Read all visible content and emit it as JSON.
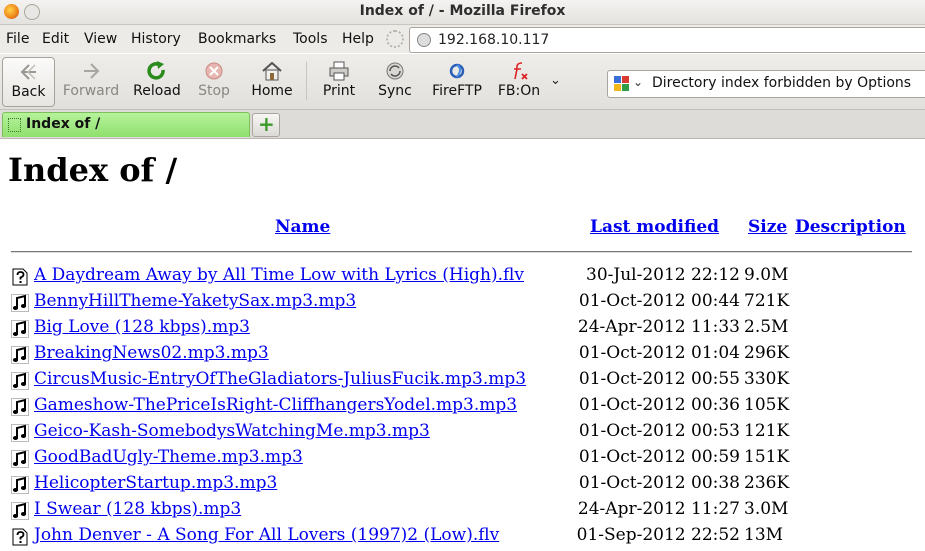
{
  "window": {
    "title": "Index of / - Mozilla Firefox"
  },
  "menu": [
    "File",
    "Edit",
    "View",
    "History",
    "Bookmarks",
    "Tools",
    "Help"
  ],
  "address": {
    "url": "192.168.10.117"
  },
  "toolbar": {
    "back": "Back",
    "forward": "Forward",
    "reload": "Reload",
    "stop": "Stop",
    "home": "Home",
    "print": "Print",
    "sync": "Sync",
    "fireftp": "FireFTP",
    "fbon": "FB:On"
  },
  "search": {
    "text": "Directory index forbidden by Options"
  },
  "tab": {
    "label": "Index of /"
  },
  "page": {
    "heading": "Index of /",
    "columns": {
      "name": "Name",
      "modified": "Last modified",
      "size": "Size",
      "description": "Description"
    },
    "rows": [
      {
        "icon": "unknown-file-icon",
        "name": "A Daydream Away by All Time Low with Lyrics (High).flv",
        "date": "30-Jul-2012 22:12",
        "size": "9.0M"
      },
      {
        "icon": "sound-file-icon",
        "name": "BennyHillTheme-YaketySax.mp3.mp3",
        "date": "01-Oct-2012 00:44",
        "size": "721K"
      },
      {
        "icon": "sound-file-icon",
        "name": "Big Love (128 kbps).mp3",
        "date": "24-Apr-2012 11:33",
        "size": "2.5M"
      },
      {
        "icon": "sound-file-icon",
        "name": "BreakingNews02.mp3.mp3",
        "date": "01-Oct-2012 01:04",
        "size": "296K"
      },
      {
        "icon": "sound-file-icon",
        "name": "CircusMusic-EntryOfTheGladiators-JuliusFucik.mp3.mp3",
        "date": "01-Oct-2012 00:55",
        "size": "330K"
      },
      {
        "icon": "sound-file-icon",
        "name": "Gameshow-ThePriceIsRight-CliffhangersYodel.mp3.mp3",
        "date": "01-Oct-2012 00:36",
        "size": "105K"
      },
      {
        "icon": "sound-file-icon",
        "name": "Geico-Kash-SomebodysWatchingMe.mp3.mp3",
        "date": "01-Oct-2012 00:53",
        "size": "121K"
      },
      {
        "icon": "sound-file-icon",
        "name": "GoodBadUgly-Theme.mp3.mp3",
        "date": "01-Oct-2012 00:59",
        "size": "151K"
      },
      {
        "icon": "sound-file-icon",
        "name": "HelicopterStartup.mp3.mp3",
        "date": "01-Oct-2012 00:38",
        "size": "236K"
      },
      {
        "icon": "sound-file-icon",
        "name": "I Swear (128 kbps).mp3",
        "date": "24-Apr-2012 11:27",
        "size": "3.0M"
      },
      {
        "icon": "unknown-file-icon",
        "name": "John Denver - A Song For All Lovers (1997)2 (Low).flv",
        "date": "01-Sep-2012 22:52",
        "size": "13M"
      }
    ]
  },
  "colors": {
    "link": "#0000ee",
    "tab_active": "#9ee87c",
    "chrome": "#edebe8"
  }
}
